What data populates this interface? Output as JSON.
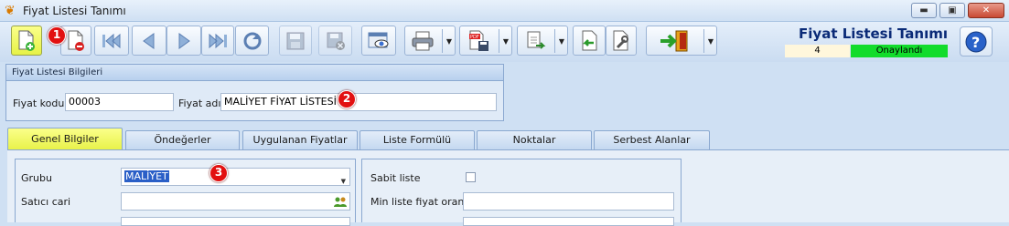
{
  "window": {
    "title": "Fiyat Listesi Tanımı",
    "controls": {
      "minimize": "▬",
      "maximize": "▣",
      "close": "✕"
    }
  },
  "toolbar": {
    "buttons": [
      {
        "name": "new",
        "icon": "new-document-icon",
        "state": "active"
      },
      {
        "name": "delete",
        "icon": "delete-document-icon",
        "state": "normal"
      },
      {
        "name": "first",
        "icon": "first-record-icon",
        "state": "normal"
      },
      {
        "name": "previous",
        "icon": "previous-record-icon",
        "state": "normal"
      },
      {
        "name": "next",
        "icon": "next-record-icon",
        "state": "normal"
      },
      {
        "name": "last",
        "icon": "last-record-icon",
        "state": "normal"
      },
      {
        "name": "refresh",
        "icon": "refresh-icon",
        "state": "normal"
      },
      {
        "name": "save",
        "icon": "save-icon",
        "state": "disabled"
      },
      {
        "name": "cancel",
        "icon": "cancel-save-icon",
        "state": "disabled"
      },
      {
        "name": "preview",
        "icon": "preview-icon",
        "state": "normal"
      },
      {
        "name": "print",
        "icon": "printer-icon",
        "state": "dropdown"
      },
      {
        "name": "export-pdf",
        "icon": "pdf-save-icon",
        "state": "dropdown"
      },
      {
        "name": "transfer",
        "icon": "transfer-icon",
        "state": "dropdown"
      },
      {
        "name": "import",
        "icon": "import-icon",
        "state": "normal"
      },
      {
        "name": "tools",
        "icon": "tools-icon",
        "state": "normal"
      },
      {
        "name": "exit",
        "icon": "exit-door-icon",
        "state": "dropdown"
      }
    ]
  },
  "header": {
    "form_title": "Fiyat Listesi Tanımı",
    "record_number": "4",
    "status": "Onaylandı",
    "status_color": "#12dc2c",
    "help_label": "?"
  },
  "info_panel": {
    "title": "Fiyat Listesi Bilgileri",
    "code_label": "Fiyat kodu",
    "code_value": "00003",
    "name_label": "Fiyat adı",
    "name_value": "MALİYET FİYAT LİSTESİ"
  },
  "tabs": [
    {
      "label": "Genel Bilgiler",
      "active": true
    },
    {
      "label": "Öndeğerler",
      "active": false
    },
    {
      "label": "Uygulanan Fiyatlar",
      "active": false
    },
    {
      "label": "Liste Formülü",
      "active": false
    },
    {
      "label": "Noktalar",
      "active": false
    },
    {
      "label": "Serbest Alanlar",
      "active": false
    }
  ],
  "general": {
    "group_label": "Grubu",
    "group_value": "MALİYET",
    "vendor_label": "Satıcı cari",
    "vendor_value": "",
    "fixed_list_label": "Sabit liste",
    "fixed_list_checked": false,
    "min_ratio_label": "Min liste fiyat oranı",
    "min_ratio_value": ""
  },
  "annotations": [
    "1",
    "2",
    "3"
  ],
  "colors": {
    "accent_yellow": "#e8f24a",
    "badge_red": "#e21010",
    "panel_blue": "#b8d0ee"
  }
}
